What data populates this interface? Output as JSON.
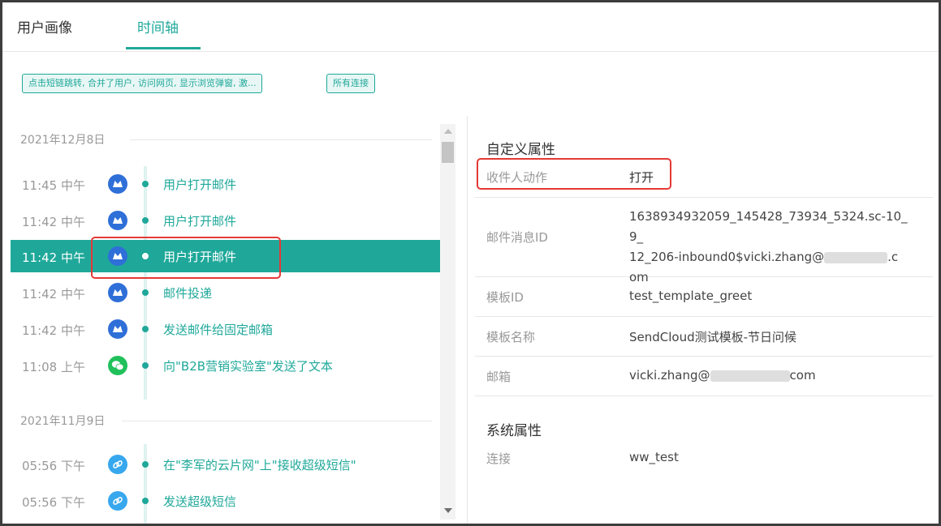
{
  "tabs": [
    {
      "label": "用户画像",
      "active": false
    },
    {
      "label": "时间轴",
      "active": true
    }
  ],
  "filters": {
    "event_filter": "点击短链跳转, 合并了用户, 访问网页, 显示浏览弹窗, 激...",
    "connection_filter": "所有连接"
  },
  "timeline": {
    "groups": [
      {
        "date": "2021年12月8日",
        "events": [
          {
            "time": "11:45 中午",
            "icon": "mail-icon",
            "title": "用户打开邮件",
            "selected": false
          },
          {
            "time": "11:42 中午",
            "icon": "mail-icon",
            "title": "用户打开邮件",
            "selected": false
          },
          {
            "time": "11:42 中午",
            "icon": "mail-icon",
            "title": "用户打开邮件",
            "selected": true
          },
          {
            "time": "11:42 中午",
            "icon": "mail-icon",
            "title": "邮件投递",
            "selected": false
          },
          {
            "time": "11:42 中午",
            "icon": "mail-icon",
            "title": "发送邮件给固定邮箱",
            "selected": false
          },
          {
            "time": "11:08 上午",
            "icon": "wechat-icon",
            "title": "向\"B2B营销实验室\"发送了文本",
            "selected": false
          }
        ]
      },
      {
        "date": "2021年11月9日",
        "events": [
          {
            "time": "05:56 下午",
            "icon": "sms-link-icon",
            "title": "在\"李军的云片网\"上\"接收超级短信\"",
            "selected": false
          },
          {
            "time": "05:56 下午",
            "icon": "sms-link-icon",
            "title": "发送超级短信",
            "selected": false
          }
        ]
      }
    ]
  },
  "details": {
    "custom_section": "自定义属性",
    "custom": {
      "action": {
        "key": "收件人动作",
        "value": "打开"
      },
      "message_id": {
        "key": "邮件消息ID",
        "line1": "1638934932059_145428_73934_5324.sc-10_9_",
        "line2_prefix": "12_206-inbound0$vicki.zhang@",
        "line2_suffix": ".c",
        "line3": "om"
      },
      "template_id": {
        "key": "模板ID",
        "value": "test_template_greet"
      },
      "template_name": {
        "key": "模板名称",
        "value": "SendCloud测试模板-节日问候"
      },
      "email": {
        "key": "邮箱",
        "prefix": "vicki.zhang@",
        "suffix": "com"
      }
    },
    "system_section": "系统属性",
    "system": {
      "connection": {
        "key": "连接",
        "value": "ww_test"
      }
    }
  },
  "colors": {
    "accent": "#1fa89a",
    "highlight_box": "#e53935",
    "mail_icon": "#2f6fd8",
    "wechat_icon": "#21c05b",
    "sms_icon": "#37a7ee"
  }
}
